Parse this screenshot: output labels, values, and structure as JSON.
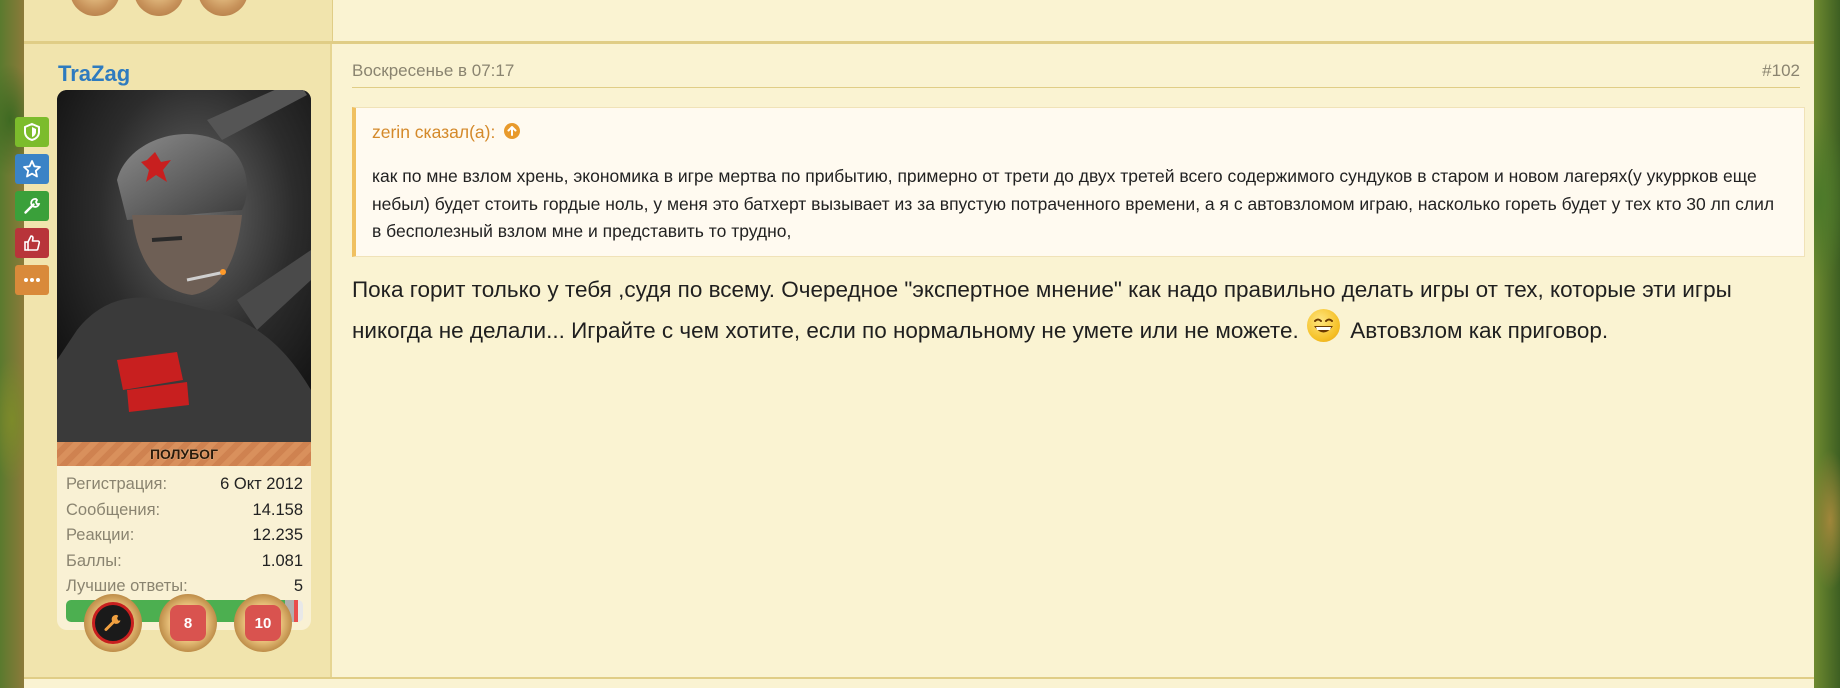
{
  "post": {
    "username": "TraZag",
    "rank": "ПОЛУБОГ",
    "date": "Воскресенье в 07:17",
    "post_number": "#102",
    "stats": [
      {
        "label": "Регистрация:",
        "value": "6 Окт 2012"
      },
      {
        "label": "Сообщения:",
        "value": "14.158"
      },
      {
        "label": "Реакции:",
        "value": "12.235"
      },
      {
        "label": "Баллы:",
        "value": "1.081"
      },
      {
        "label": "Лучшие ответы:",
        "value": "5"
      }
    ],
    "progress_fraction": 0.96,
    "side_badges": [
      {
        "icon": "shield-icon",
        "color": "#7cbc2c"
      },
      {
        "icon": "star-icon",
        "color": "#3b83c6"
      },
      {
        "icon": "wrench-icon",
        "color": "#3aa03a"
      },
      {
        "icon": "thumbs-up-icon",
        "color": "#b8343a"
      },
      {
        "icon": "more-icon",
        "color": "#d98a3a"
      }
    ],
    "trophies": [
      {
        "icon": "wrench-trophy-icon",
        "label": ""
      },
      {
        "icon": "hexagon-trophy-icon",
        "label": "8"
      },
      {
        "icon": "hexagon-trophy-icon",
        "label": "10"
      }
    ],
    "quote": {
      "author": "zerin сказал(а):",
      "text": "как по мне взлом хрень, экономика в игре мертва по прибытию, примерно от трети до двух третей всего содержимого сундуков в старом и новом лагерях(у укурр­ков еще небыл) будет стоить гордые ноль, у меня это батхерт вызывает из за впустую потраченного времени, а я с автовзломом играю, насколько гореть будет у тех кто 30 лп слил в бесполезный взлом мне и представить то трудно,"
    },
    "message_part1": "Пока горит только у тебя ,судя по всему. Очередное \"экспертное мнение\" как надо правильно делать игры от тех, которые эти игры никогда не делали... Играйте с чем хотите, если по нормальному не умете или не можете.",
    "message_part2": "Автовзлом как приговор."
  },
  "colors": {
    "username": "#2e7bbf",
    "quote_author": "#d4892a",
    "page_bg": "#faf3d2",
    "sidebar_bg": "#f1e4ad"
  }
}
